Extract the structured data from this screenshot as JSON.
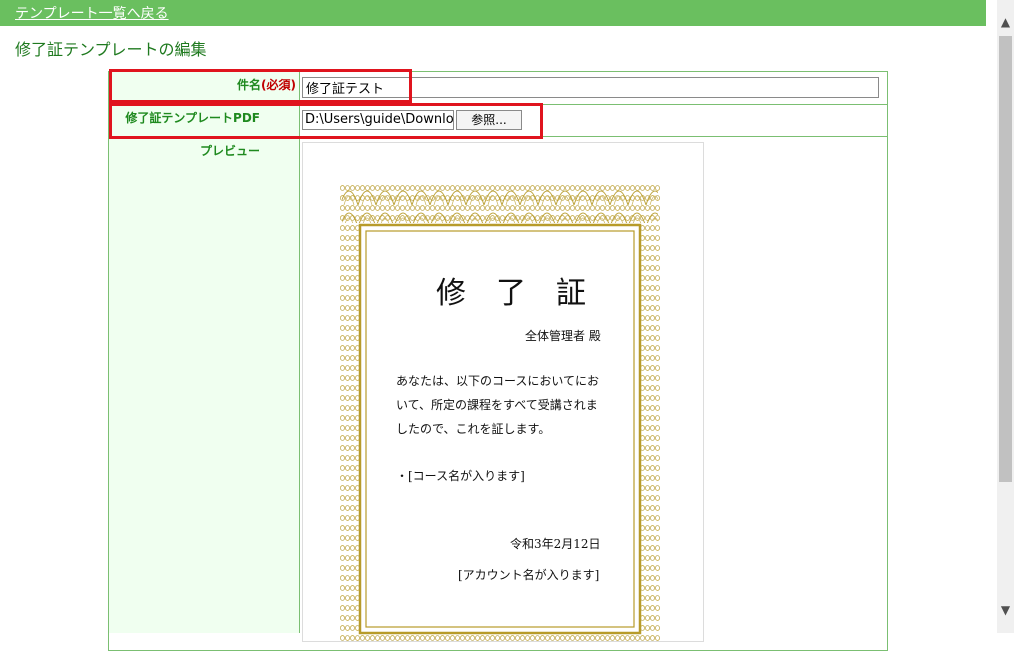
{
  "nav": {
    "back_link": "テンプレート一覧へ戻る"
  },
  "page": {
    "title": "修了証テンプレートの編集"
  },
  "form": {
    "name_label": "件名",
    "name_required": "(必須)",
    "name_value": "修了証テスト",
    "pdf_label": "修了証テンプレートPDF",
    "pdf_path": "D:\\Users\\guide\\Downloac",
    "browse_button": "参照...",
    "preview_label": "プレビュー"
  },
  "certificate": {
    "title": "修　了　証",
    "recipient": "全体管理者 殿",
    "body_line1": "あなたは、以下のコースにおいてにお",
    "body_line2": "いて、所定の課程をすべて受講されま",
    "body_line3": "したので、これを証します。",
    "course": "・[コース名が入ります]",
    "date": "令和3年2月12日",
    "account": "[アカウント名が入ります]"
  },
  "colors": {
    "topbar": "#6abf5f",
    "label_green": "#1f8a1f",
    "highlight": "#e0141e",
    "cert_border": "#b79b2a"
  }
}
